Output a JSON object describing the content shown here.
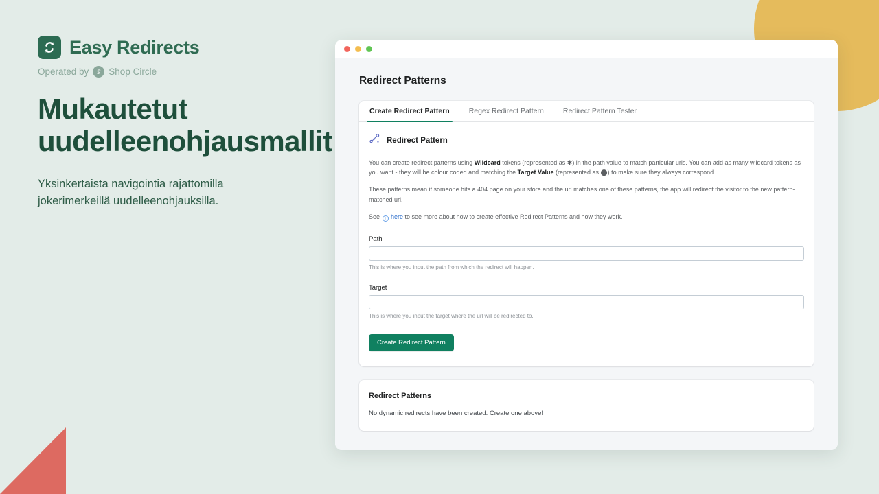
{
  "theme": {
    "background": "#e3ece8",
    "brand_green": "#2f6b52",
    "headline_green": "#1e4f3b",
    "accent_button": "#108060",
    "deco_yellow": "#e5bb5c",
    "deco_red": "#dd6a61",
    "link_blue": "#2c6ecb"
  },
  "marketing": {
    "logo_icon": "refresh-arrows-icon",
    "brand_name": "Easy Redirects",
    "operated_by_label": "Operated by",
    "operated_by_icon": "shop-circle-icon",
    "operated_by_company": "Shop Circle",
    "headline": "Mukautetut uudelleenohjausmallit",
    "subheadline": "Yksinkertaista navigointia rajattomilla jokerimerkeillä uudelleenohjauksilla."
  },
  "window": {
    "traffic_lights": [
      "close-red",
      "minimize-yellow",
      "maximize-green"
    ]
  },
  "app": {
    "page_title": "Redirect Patterns",
    "tabs": [
      {
        "label": "Create Redirect Pattern",
        "active": true
      },
      {
        "label": "Regex Redirect Pattern",
        "active": false
      },
      {
        "label": "Redirect Pattern Tester",
        "active": false
      }
    ],
    "section": {
      "icon": "path-nodes-icon",
      "title": "Redirect Pattern",
      "paragraph_1": {
        "part_1": "You can create redirect patterns using ",
        "bold_1": "Wildcard",
        "part_2": " tokens (represented as ",
        "glyph_1": "✱",
        "part_3": ") in the path value to match particular urls. You can add as many wildcard tokens as you want - they will be colour coded and matching the ",
        "bold_2": "Target Value",
        "part_4": " (represented as ",
        "glyph_2": "⬤",
        "part_5": ") to make sure they always correspond."
      },
      "paragraph_2": "These patterns mean if someone hits a 404 page on your store and the url matches one of these patterns, the app will redirect the visitor to the new pattern-matched url.",
      "paragraph_3": {
        "part_1": "See ",
        "icon": "info-icon",
        "link_text": "here",
        "part_2": " to see more about how to create effective Redirect Patterns and how they work."
      }
    },
    "form": {
      "path_label": "Path",
      "path_value": "",
      "path_placeholder": "",
      "path_help": "This is where you input the path from which the redirect will happen.",
      "target_label": "Target",
      "target_value": "",
      "target_placeholder": "",
      "target_help": "This is where you input the target where the url will be redirected to.",
      "submit_label": "Create Redirect Pattern"
    },
    "list_card": {
      "title": "Redirect Patterns",
      "empty_message": "No dynamic redirects have been created. Create one above!"
    }
  }
}
